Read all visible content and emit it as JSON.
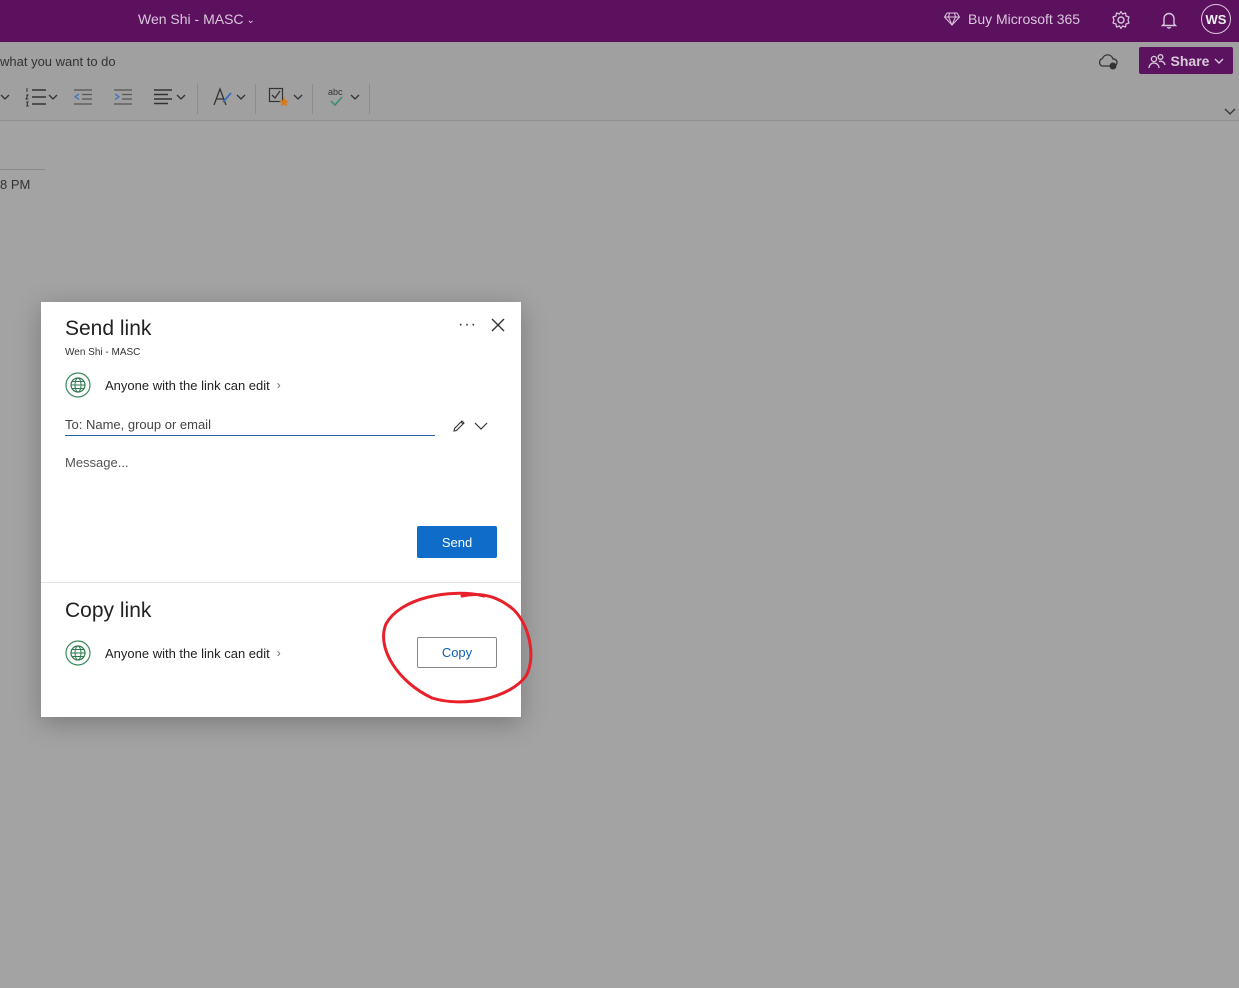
{
  "titlebar": {
    "doc_title": "Wen Shi - MASC",
    "buy_label": "Buy Microsoft 365",
    "avatar_initials": "WS",
    "bg_color": "#5c115f"
  },
  "ribbon": {
    "tell_me_text": "what you want to do",
    "share_label": "Share"
  },
  "page": {
    "time_fragment": "8 PM"
  },
  "dialog": {
    "send_title": "Send link",
    "send_subtitle": "Wen Shi - MASC",
    "send_permission": "Anyone with the link can edit",
    "to_placeholder": "To: Name, group or email",
    "message_placeholder": "Message...",
    "send_label": "Send",
    "copy_title": "Copy link",
    "copy_permission": "Anyone with the link can edit",
    "copy_label": "Copy",
    "accent_color": "#0f6cc8"
  },
  "annotation": {
    "color": "#e8202a",
    "target": "copy-button"
  }
}
